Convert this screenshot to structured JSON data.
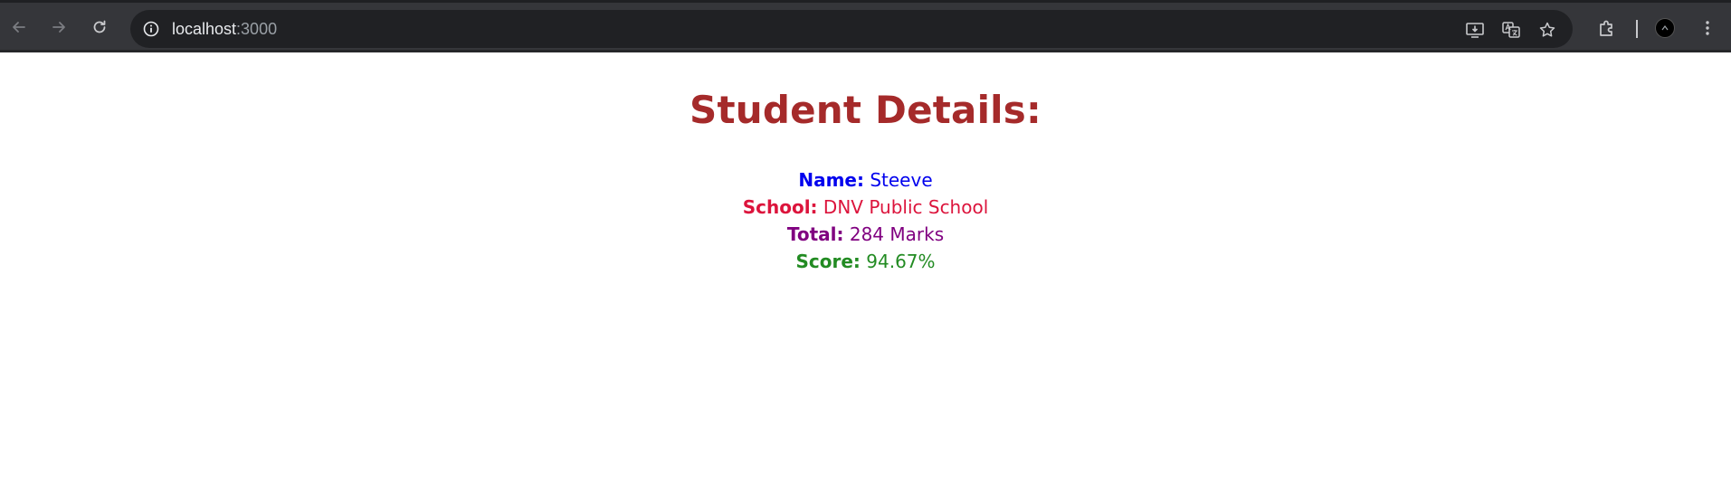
{
  "browser": {
    "url_host": "localhost",
    "url_port": ":3000",
    "icons": [
      "back-arrow-icon",
      "forward-arrow-icon",
      "reload-icon",
      "site-info-icon",
      "install-app-icon",
      "translate-icon",
      "bookmark-star-icon",
      "extensions-icon",
      "profile-avatar",
      "menu-kebab-icon"
    ]
  },
  "page": {
    "title": "Student Details:",
    "details": {
      "name_label": "Name:",
      "name_value": "Steeve",
      "school_label": "School:",
      "school_value": "DNV Public School",
      "total_label": "Total:",
      "total_value": "284 Marks",
      "score_label": "Score:",
      "score_value": "94.67%"
    }
  },
  "colors": {
    "title": "#a52a2a",
    "name": "#0000ee",
    "school": "#dc143c",
    "total": "#800080",
    "score": "#228b22"
  }
}
